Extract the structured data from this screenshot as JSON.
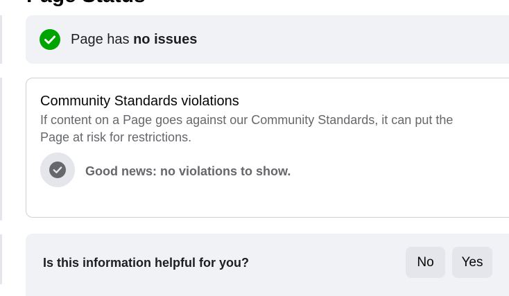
{
  "header": {
    "title": "Page Status"
  },
  "status": {
    "prefix": "Page has ",
    "emphasis": "no issues",
    "icon": "check-circle-icon",
    "color": "#00a400"
  },
  "violations": {
    "title": "Community Standards violations",
    "description": "If content on a Page goes against our Community Standards, it can put the Page at risk for restrictions.",
    "empty_state_icon": "check-circle-icon",
    "empty_state_text": "Good news: no violations to show."
  },
  "feedback": {
    "question": "Is this information helpful for you?",
    "no_label": "No",
    "yes_label": "Yes"
  },
  "colors": {
    "success": "#00a400",
    "muted_icon": "#65676b",
    "card_bg": "#f0f2f5",
    "button_bg": "#e4e6eb"
  }
}
